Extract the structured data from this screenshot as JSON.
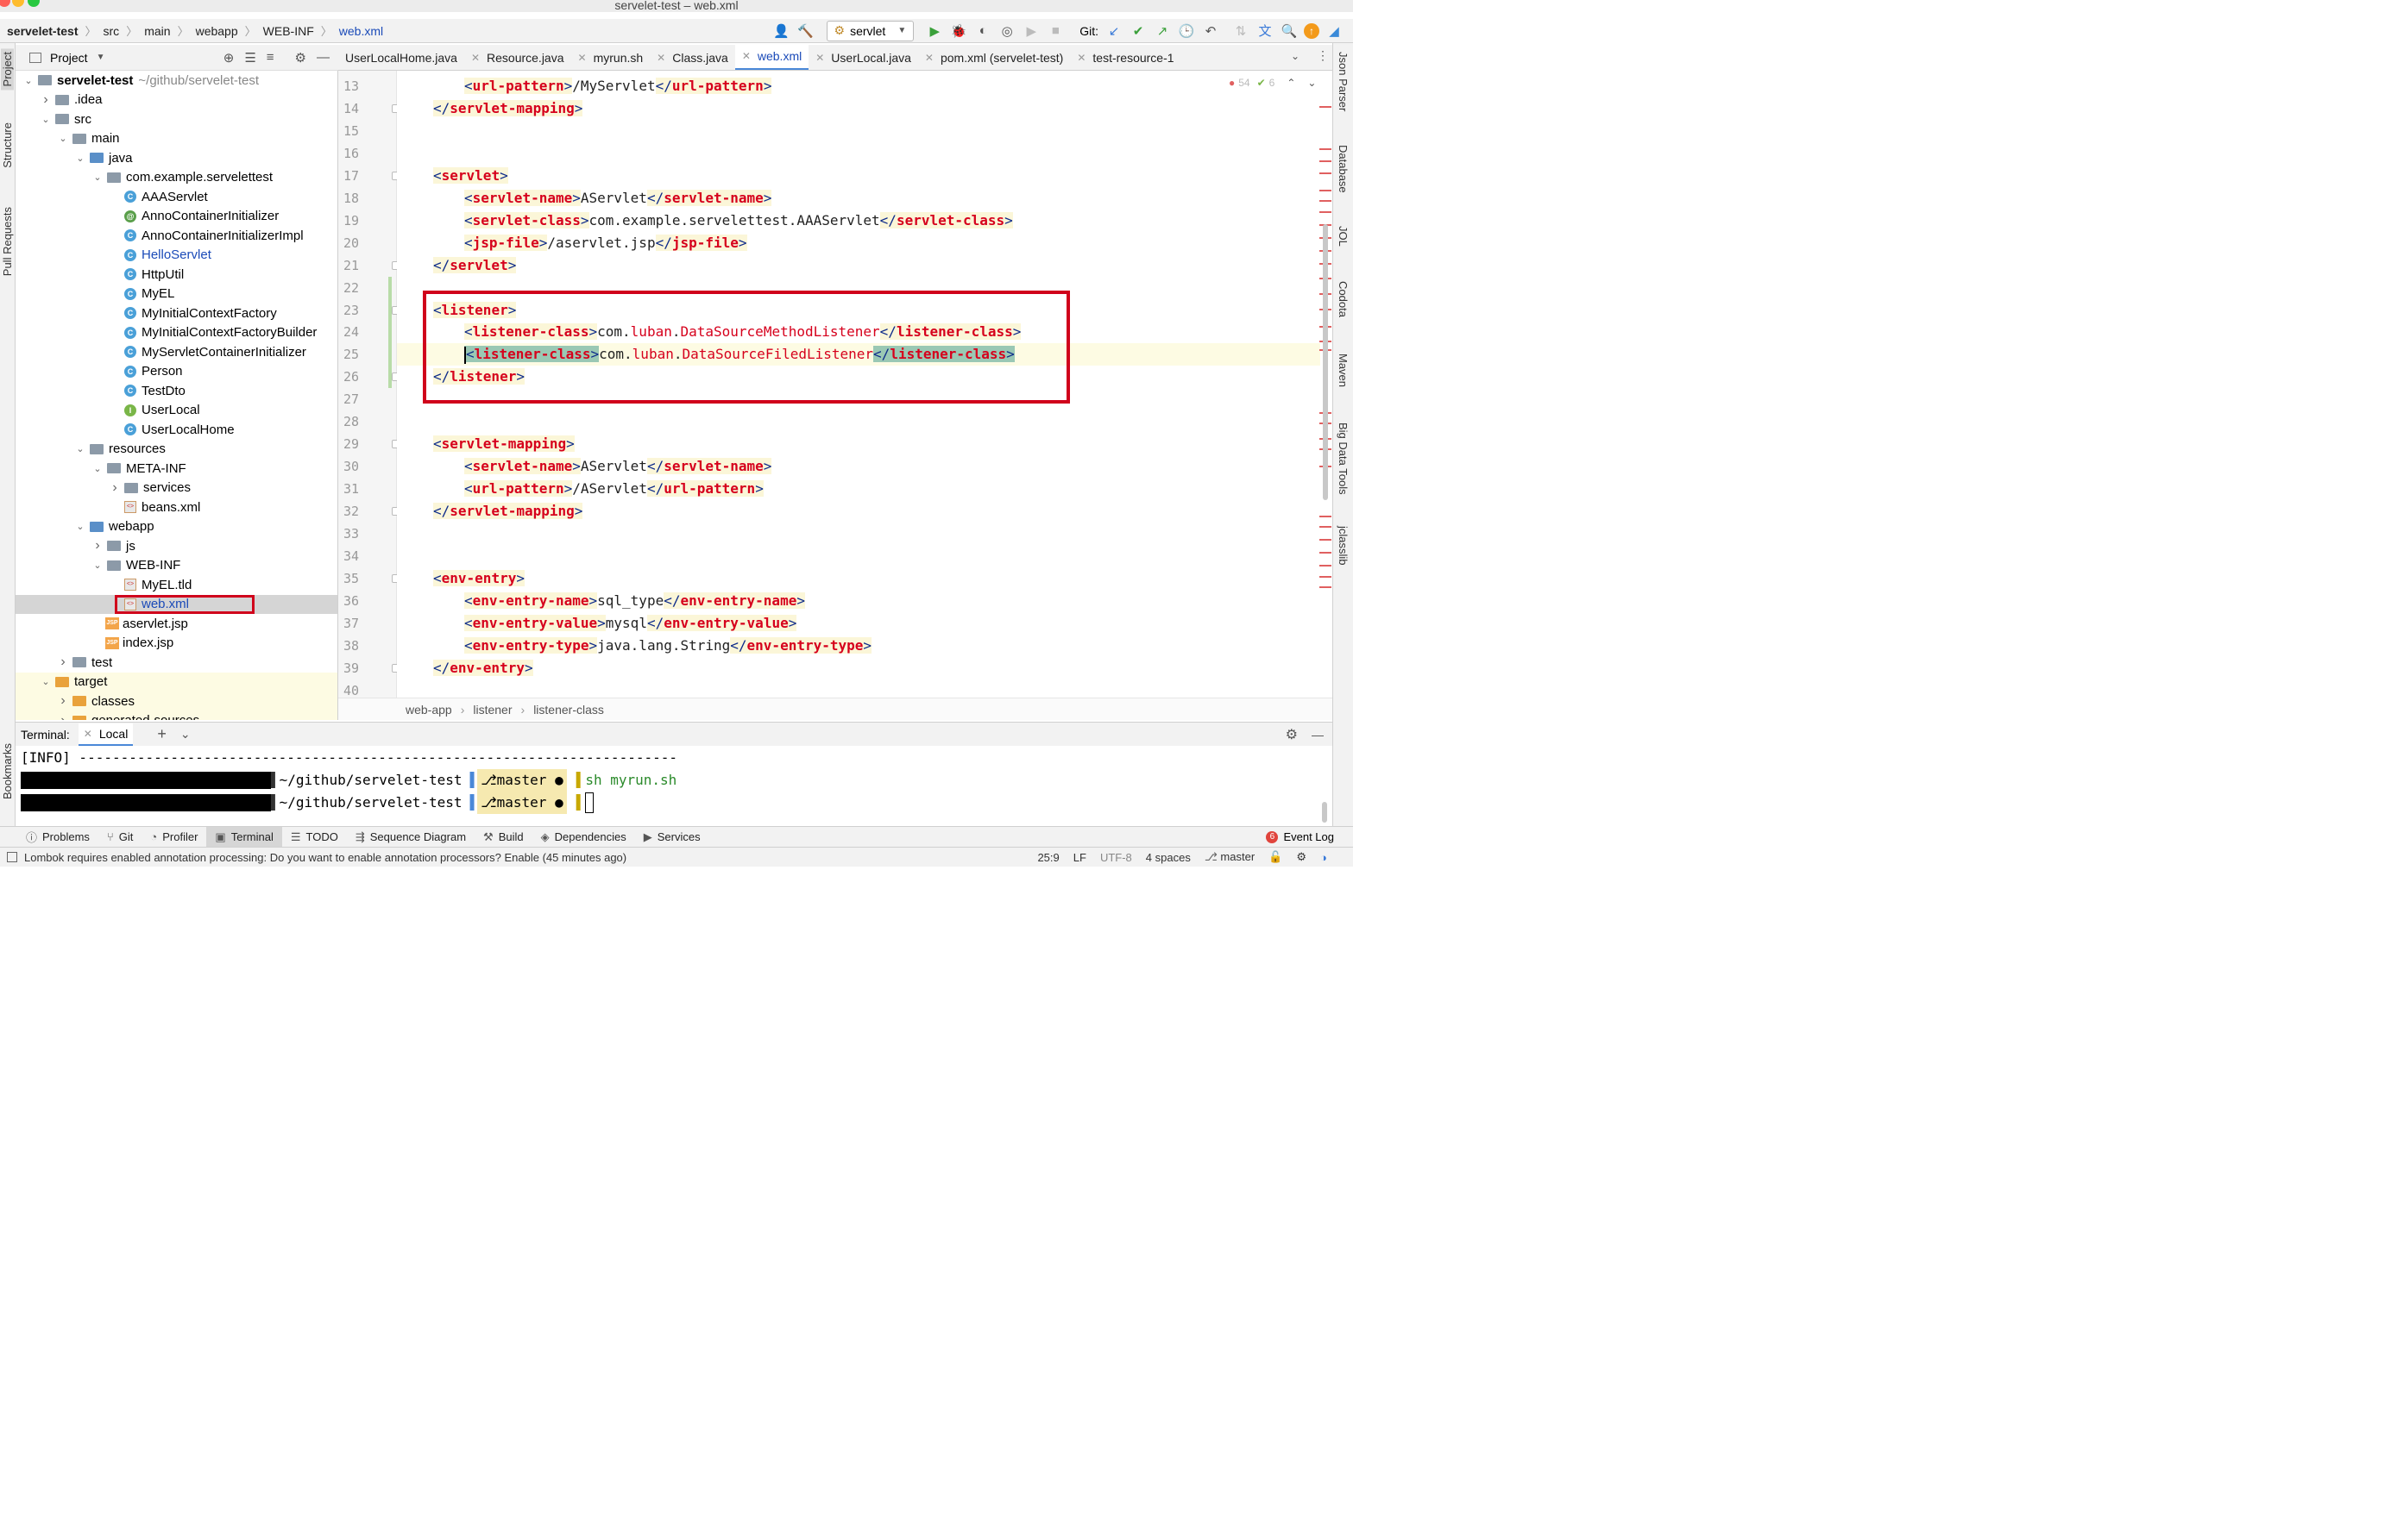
{
  "window": {
    "title": "servelet-test – web.xml"
  },
  "nav": {
    "crumbs": [
      "servelet-test",
      "src",
      "main",
      "webapp",
      "WEB-INF",
      "web.xml"
    ],
    "run_config": "servlet",
    "git_label": "Git:"
  },
  "project_panel": {
    "title": "Project"
  },
  "tree": [
    {
      "label": "servelet-test",
      "extra": "~/github/servelet-test",
      "indent": 0,
      "arrow": "v",
      "icon": "folder",
      "bold": true
    },
    {
      "label": ".idea",
      "indent": 1,
      "arrow": ">",
      "icon": "folder"
    },
    {
      "label": "src",
      "indent": 1,
      "arrow": "v",
      "icon": "folder"
    },
    {
      "label": "main",
      "indent": 2,
      "arrow": "v",
      "icon": "folder"
    },
    {
      "label": "java",
      "indent": 3,
      "arrow": "v",
      "icon": "folder-blue"
    },
    {
      "label": "com.example.servelettest",
      "indent": 4,
      "arrow": "v",
      "icon": "folder"
    },
    {
      "label": "AAAServlet",
      "indent": 5,
      "icon": "class"
    },
    {
      "label": "AnnoContainerInitializer",
      "indent": 5,
      "icon": "annotation"
    },
    {
      "label": "AnnoContainerInitializerImpl",
      "indent": 5,
      "icon": "class"
    },
    {
      "label": "HelloServlet",
      "indent": 5,
      "icon": "class",
      "blue": true
    },
    {
      "label": "HttpUtil",
      "indent": 5,
      "icon": "class"
    },
    {
      "label": "MyEL",
      "indent": 5,
      "icon": "class"
    },
    {
      "label": "MyInitialContextFactory",
      "indent": 5,
      "icon": "class"
    },
    {
      "label": "MyInitialContextFactoryBuilder",
      "indent": 5,
      "icon": "class"
    },
    {
      "label": "MyServletContainerInitializer",
      "indent": 5,
      "icon": "class"
    },
    {
      "label": "Person",
      "indent": 5,
      "icon": "class"
    },
    {
      "label": "TestDto",
      "indent": 5,
      "icon": "class"
    },
    {
      "label": "UserLocal",
      "indent": 5,
      "icon": "interface"
    },
    {
      "label": "UserLocalHome",
      "indent": 5,
      "icon": "class"
    },
    {
      "label": "resources",
      "indent": 3,
      "arrow": "v",
      "icon": "folder"
    },
    {
      "label": "META-INF",
      "indent": 4,
      "arrow": "v",
      "icon": "folder"
    },
    {
      "label": "services",
      "indent": 5,
      "arrow": ">",
      "icon": "folder"
    },
    {
      "label": "beans.xml",
      "indent": 5,
      "icon": "xml"
    },
    {
      "label": "webapp",
      "indent": 3,
      "arrow": "v",
      "icon": "folder-blue"
    },
    {
      "label": "js",
      "indent": 4,
      "arrow": ">",
      "icon": "folder"
    },
    {
      "label": "WEB-INF",
      "indent": 4,
      "arrow": "v",
      "icon": "folder"
    },
    {
      "label": "MyEL.tld",
      "indent": 5,
      "icon": "xml"
    },
    {
      "label": "web.xml",
      "indent": 5,
      "icon": "xml",
      "selected": true,
      "blue": true
    },
    {
      "label": "aservlet.jsp",
      "indent": 4,
      "icon": "jsp"
    },
    {
      "label": "index.jsp",
      "indent": 4,
      "icon": "jsp"
    },
    {
      "label": "test",
      "indent": 2,
      "arrow": ">",
      "icon": "folder"
    },
    {
      "label": "target",
      "indent": 1,
      "arrow": "v",
      "icon": "folder-orange",
      "yellow": true
    },
    {
      "label": "classes",
      "indent": 2,
      "arrow": ">",
      "icon": "folder-orange",
      "yellow": true
    },
    {
      "label": "generated-sources",
      "indent": 2,
      "arrow": ">",
      "icon": "folder-orange",
      "yellow": true
    }
  ],
  "tabs": [
    {
      "label": "UserLocalHome.java"
    },
    {
      "label": "Resource.java"
    },
    {
      "label": "myrun.sh"
    },
    {
      "label": "Class.java"
    },
    {
      "label": "web.xml",
      "active": true
    },
    {
      "label": "UserLocal.java"
    },
    {
      "label": "pom.xml (servelet-test)"
    },
    {
      "label": "test-resource-1"
    }
  ],
  "inspection": {
    "warnings": "54",
    "ok": "6"
  },
  "code": [
    {
      "n": "13",
      "indent": 1,
      "tag": "url-pattern",
      "text": "/MyServlet"
    },
    {
      "n": "14",
      "indent": 0,
      "close": "servlet-mapping"
    },
    {
      "n": "15"
    },
    {
      "n": "16"
    },
    {
      "n": "17",
      "indent": 0,
      "open": "servlet"
    },
    {
      "n": "18",
      "indent": 1,
      "tag": "servlet-name",
      "text": "AServlet"
    },
    {
      "n": "19",
      "indent": 1,
      "tag": "servlet-class",
      "text": "com.example.servelettest.AAAServlet"
    },
    {
      "n": "20",
      "indent": 1,
      "tag": "jsp-file",
      "text": "/aservlet.jsp"
    },
    {
      "n": "21",
      "indent": 0,
      "close": "servlet"
    },
    {
      "n": "22"
    },
    {
      "n": "23",
      "indent": 0,
      "open": "listener"
    },
    {
      "n": "24",
      "indent": 1,
      "tag": "listener-class",
      "text": "com.luban.DataSourceMethodListener"
    },
    {
      "n": "25",
      "indent": 1,
      "tag": "listener-class",
      "text": "com.luban.DataSourceFiledListener",
      "current": true
    },
    {
      "n": "26",
      "indent": 0,
      "close": "listener"
    },
    {
      "n": "27"
    },
    {
      "n": "28"
    },
    {
      "n": "29",
      "indent": 0,
      "open": "servlet-mapping"
    },
    {
      "n": "30",
      "indent": 1,
      "tag": "servlet-name",
      "text": "AServlet"
    },
    {
      "n": "31",
      "indent": 1,
      "tag": "url-pattern",
      "text": "/AServlet"
    },
    {
      "n": "32",
      "indent": 0,
      "close": "servlet-mapping"
    },
    {
      "n": "33"
    },
    {
      "n": "34"
    },
    {
      "n": "35",
      "indent": 0,
      "open": "env-entry"
    },
    {
      "n": "36",
      "indent": 1,
      "tag": "env-entry-name",
      "text": "sql_type"
    },
    {
      "n": "37",
      "indent": 1,
      "tag": "env-entry-value",
      "text": "mysql"
    },
    {
      "n": "38",
      "indent": 1,
      "tag": "env-entry-type",
      "text": "java.lang.String"
    },
    {
      "n": "39",
      "indent": 0,
      "close": "env-entry"
    },
    {
      "n": "40"
    }
  ],
  "editor_breadcrumb": [
    "web-app",
    "listener",
    "listener-class"
  ],
  "right_tools": [
    "Json Parser",
    "Database",
    "JOL",
    "Codota",
    "Maven",
    "Big Data Tools",
    "jclasslib"
  ],
  "left_tools": [
    "Project",
    "Structure",
    "Pull Requests",
    "Bookmarks"
  ],
  "terminal": {
    "label": "Terminal:",
    "tab": "Local",
    "info_line": "[INFO] ------------------------------------------------------------------------",
    "path": "~/github/servelet-test",
    "branch": "master",
    "cmd": "sh myrun.sh"
  },
  "tool_windows": [
    "Problems",
    "Git",
    "Profiler",
    "Terminal",
    "TODO",
    "Sequence Diagram",
    "Build",
    "Dependencies",
    "Services"
  ],
  "event_log": {
    "count": "6",
    "label": "Event Log"
  },
  "status": {
    "message": "Lombok requires enabled annotation processing: Do you want to enable annotation processors? Enable (45 minutes ago)",
    "position": "25:9",
    "line_sep": "LF",
    "encoding": "UTF-8",
    "indent": "4 spaces",
    "branch": "master"
  },
  "colors": {
    "tag": "#d6001c",
    "bracket": "#0d2b8a",
    "highlight_box": "#d0021b",
    "tab_underline": "#4a88d8"
  }
}
